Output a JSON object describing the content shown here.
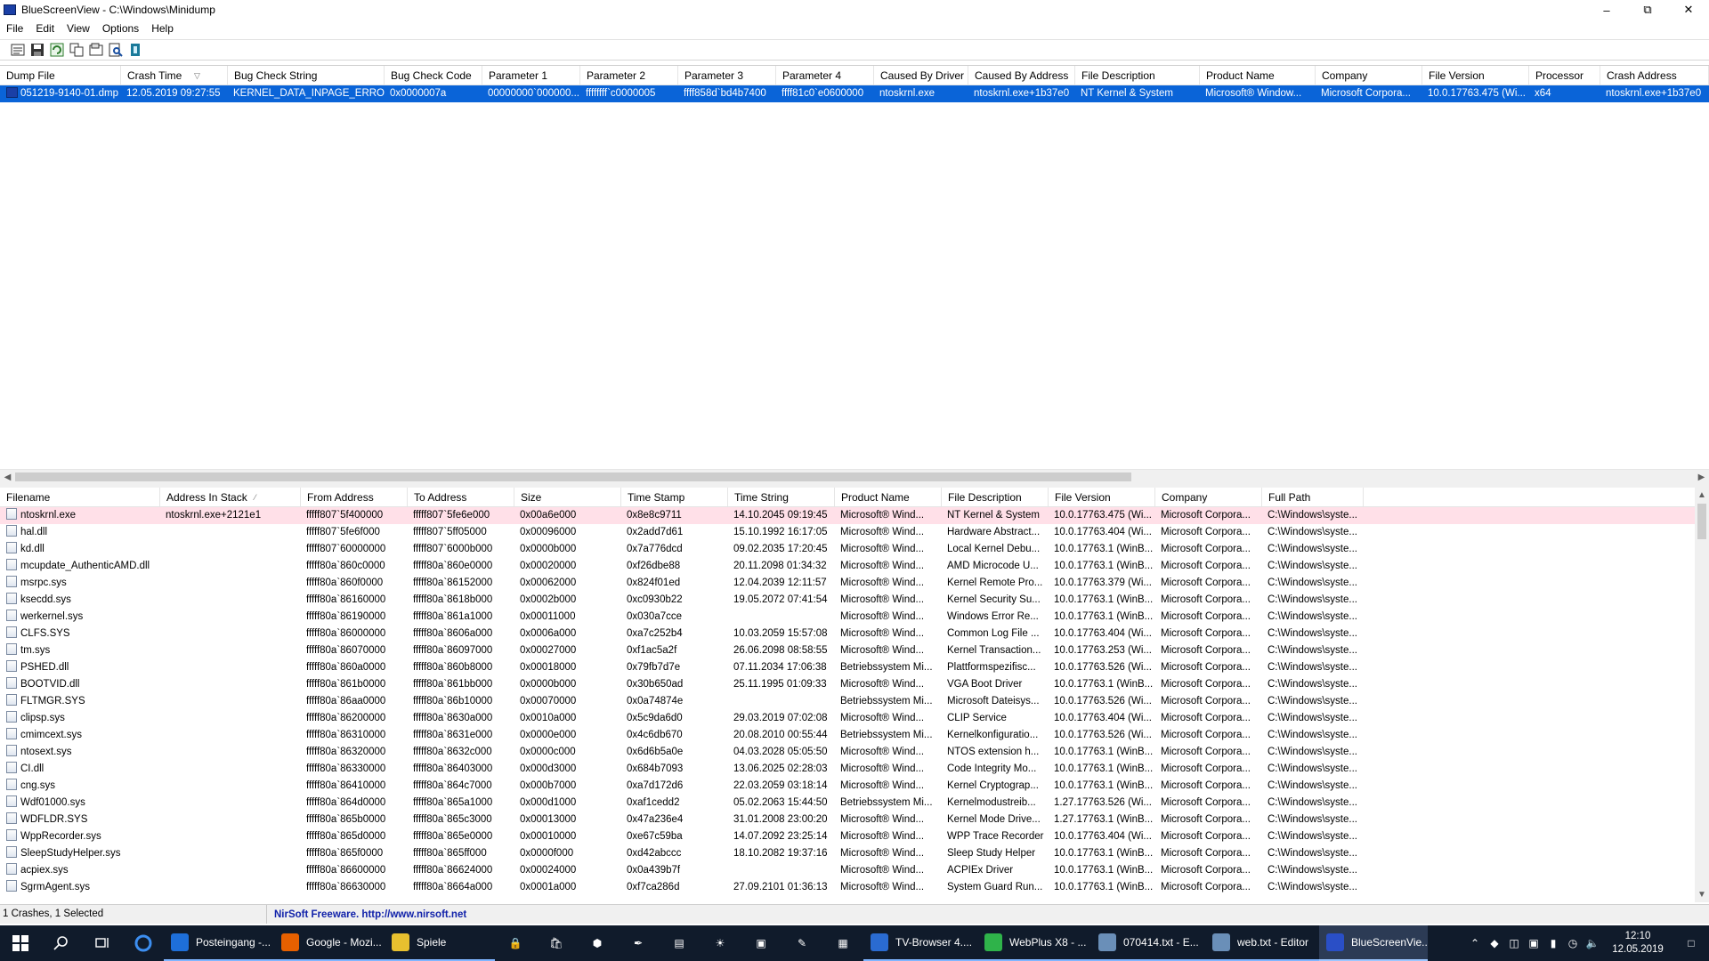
{
  "window": {
    "title": "BlueScreenView  -  C:\\Windows\\Minidump"
  },
  "menu": [
    "File",
    "Edit",
    "View",
    "Options",
    "Help"
  ],
  "toolbar": [
    "properties-icon",
    "save-icon",
    "refresh-icon",
    "copy-icon",
    "html-report-icon",
    "find-icon",
    "exit-icon"
  ],
  "top_table": {
    "columns": [
      "Dump File",
      "Crash Time",
      "Bug Check String",
      "Bug Check Code",
      "Parameter 1",
      "Parameter 2",
      "Parameter 3",
      "Parameter 4",
      "Caused By Driver",
      "Caused By Address",
      "File Description",
      "Product Name",
      "Company",
      "File Version",
      "Processor",
      "Crash Address"
    ],
    "sorted_column": "Crash Time",
    "rows": [
      [
        "051219-9140-01.dmp",
        "12.05.2019 09:27:55",
        "KERNEL_DATA_INPAGE_ERROR",
        "0x0000007a",
        "00000000`000000...",
        "ffffffff`c0000005",
        "ffff858d`bd4b7400",
        "ffff81c0`e0600000",
        "ntoskrnl.exe",
        "ntoskrnl.exe+1b37e0",
        "NT Kernel & System",
        "Microsoft® Window...",
        "Microsoft Corpora...",
        "10.0.17763.475 (Wi...",
        "x64",
        "ntoskrnl.exe+1b37e0"
      ]
    ]
  },
  "bottom_table": {
    "columns": [
      "Filename",
      "Address In Stack",
      "From Address",
      "To Address",
      "Size",
      "Time Stamp",
      "Time String",
      "Product Name",
      "File Description",
      "File Version",
      "Company",
      "Full Path"
    ],
    "sorted_column": "Address In Stack",
    "rows": [
      [
        "ntoskrnl.exe",
        "ntoskrnl.exe+2121e1",
        "fffff807`5f400000",
        "fffff807`5fe6e000",
        "0x00a6e000",
        "0x8e8c9711",
        "14.10.2045 09:19:45",
        "Microsoft® Wind...",
        "NT Kernel & System",
        "10.0.17763.475 (Wi...",
        "Microsoft Corpora...",
        "C:\\Windows\\syste..."
      ],
      [
        "hal.dll",
        "",
        "fffff807`5fe6f000",
        "fffff807`5ff05000",
        "0x00096000",
        "0x2add7d61",
        "15.10.1992 16:17:05",
        "Microsoft® Wind...",
        "Hardware Abstract...",
        "10.0.17763.404 (Wi...",
        "Microsoft Corpora...",
        "C:\\Windows\\syste..."
      ],
      [
        "kd.dll",
        "",
        "fffff807`60000000",
        "fffff807`6000b000",
        "0x0000b000",
        "0x7a776dcd",
        "09.02.2035 17:20:45",
        "Microsoft® Wind...",
        "Local Kernel Debu...",
        "10.0.17763.1 (WinB...",
        "Microsoft Corpora...",
        "C:\\Windows\\syste..."
      ],
      [
        "mcupdate_AuthenticAMD.dll",
        "",
        "fffff80a`860c0000",
        "fffff80a`860e0000",
        "0x00020000",
        "0xf26dbe88",
        "20.11.2098 01:34:32",
        "Microsoft® Wind...",
        "AMD Microcode U...",
        "10.0.17763.1 (WinB...",
        "Microsoft Corpora...",
        "C:\\Windows\\syste..."
      ],
      [
        "msrpc.sys",
        "",
        "fffff80a`860f0000",
        "fffff80a`86152000",
        "0x00062000",
        "0x824f01ed",
        "12.04.2039 12:11:57",
        "Microsoft® Wind...",
        "Kernel Remote Pro...",
        "10.0.17763.379 (Wi...",
        "Microsoft Corpora...",
        "C:\\Windows\\syste..."
      ],
      [
        "ksecdd.sys",
        "",
        "fffff80a`86160000",
        "fffff80a`8618b000",
        "0x0002b000",
        "0xc0930b22",
        "19.05.2072 07:41:54",
        "Microsoft® Wind...",
        "Kernel Security Su...",
        "10.0.17763.1 (WinB...",
        "Microsoft Corpora...",
        "C:\\Windows\\syste..."
      ],
      [
        "werkernel.sys",
        "",
        "fffff80a`86190000",
        "fffff80a`861a1000",
        "0x00011000",
        "0x030a7cce",
        "",
        "Microsoft® Wind...",
        "Windows Error Re...",
        "10.0.17763.1 (WinB...",
        "Microsoft Corpora...",
        "C:\\Windows\\syste..."
      ],
      [
        "CLFS.SYS",
        "",
        "fffff80a`86000000",
        "fffff80a`8606a000",
        "0x0006a000",
        "0xa7c252b4",
        "10.03.2059 15:57:08",
        "Microsoft® Wind...",
        "Common Log File ...",
        "10.0.17763.404 (Wi...",
        "Microsoft Corpora...",
        "C:\\Windows\\syste..."
      ],
      [
        "tm.sys",
        "",
        "fffff80a`86070000",
        "fffff80a`86097000",
        "0x00027000",
        "0xf1ac5a2f",
        "26.06.2098 08:58:55",
        "Microsoft® Wind...",
        "Kernel Transaction...",
        "10.0.17763.253 (Wi...",
        "Microsoft Corpora...",
        "C:\\Windows\\syste..."
      ],
      [
        "PSHED.dll",
        "",
        "fffff80a`860a0000",
        "fffff80a`860b8000",
        "0x00018000",
        "0x79fb7d7e",
        "07.11.2034 17:06:38",
        "Betriebssystem Mi...",
        "Plattformspezifisc...",
        "10.0.17763.526 (Wi...",
        "Microsoft Corpora...",
        "C:\\Windows\\syste..."
      ],
      [
        "BOOTVID.dll",
        "",
        "fffff80a`861b0000",
        "fffff80a`861bb000",
        "0x0000b000",
        "0x30b650ad",
        "25.11.1995 01:09:33",
        "Microsoft® Wind...",
        "VGA Boot Driver",
        "10.0.17763.1 (WinB...",
        "Microsoft Corpora...",
        "C:\\Windows\\syste..."
      ],
      [
        "FLTMGR.SYS",
        "",
        "fffff80a`86aa0000",
        "fffff80a`86b10000",
        "0x00070000",
        "0x0a74874e",
        "",
        "Betriebssystem Mi...",
        "Microsoft Dateisys...",
        "10.0.17763.526 (Wi...",
        "Microsoft Corpora...",
        "C:\\Windows\\syste..."
      ],
      [
        "clipsp.sys",
        "",
        "fffff80a`86200000",
        "fffff80a`8630a000",
        "0x0010a000",
        "0x5c9da6d0",
        "29.03.2019 07:02:08",
        "Microsoft® Wind...",
        "CLIP Service",
        "10.0.17763.404 (Wi...",
        "Microsoft Corpora...",
        "C:\\Windows\\syste..."
      ],
      [
        "cmimcext.sys",
        "",
        "fffff80a`86310000",
        "fffff80a`8631e000",
        "0x0000e000",
        "0x4c6db670",
        "20.08.2010 00:55:44",
        "Betriebssystem Mi...",
        "Kernelkonfiguratio...",
        "10.0.17763.526 (Wi...",
        "Microsoft Corpora...",
        "C:\\Windows\\syste..."
      ],
      [
        "ntosext.sys",
        "",
        "fffff80a`86320000",
        "fffff80a`8632c000",
        "0x0000c000",
        "0x6d6b5a0e",
        "04.03.2028 05:05:50",
        "Microsoft® Wind...",
        "NTOS extension h...",
        "10.0.17763.1 (WinB...",
        "Microsoft Corpora...",
        "C:\\Windows\\syste..."
      ],
      [
        "CI.dll",
        "",
        "fffff80a`86330000",
        "fffff80a`86403000",
        "0x000d3000",
        "0x684b7093",
        "13.06.2025 02:28:03",
        "Microsoft® Wind...",
        "Code Integrity Mo...",
        "10.0.17763.1 (WinB...",
        "Microsoft Corpora...",
        "C:\\Windows\\syste..."
      ],
      [
        "cng.sys",
        "",
        "fffff80a`86410000",
        "fffff80a`864c7000",
        "0x000b7000",
        "0xa7d172d6",
        "22.03.2059 03:18:14",
        "Microsoft® Wind...",
        "Kernel Cryptograp...",
        "10.0.17763.1 (WinB...",
        "Microsoft Corpora...",
        "C:\\Windows\\syste..."
      ],
      [
        "Wdf01000.sys",
        "",
        "fffff80a`864d0000",
        "fffff80a`865a1000",
        "0x000d1000",
        "0xaf1cedd2",
        "05.02.2063 15:44:50",
        "Betriebssystem Mi...",
        "Kernelmodustreib...",
        "1.27.17763.526 (Wi...",
        "Microsoft Corpora...",
        "C:\\Windows\\syste..."
      ],
      [
        "WDFLDR.SYS",
        "",
        "fffff80a`865b0000",
        "fffff80a`865c3000",
        "0x00013000",
        "0x47a236e4",
        "31.01.2008 23:00:20",
        "Microsoft® Wind...",
        "Kernel Mode Drive...",
        "1.27.17763.1 (WinB...",
        "Microsoft Corpora...",
        "C:\\Windows\\syste..."
      ],
      [
        "WppRecorder.sys",
        "",
        "fffff80a`865d0000",
        "fffff80a`865e0000",
        "0x00010000",
        "0xe67c59ba",
        "14.07.2092 23:25:14",
        "Microsoft® Wind...",
        "WPP Trace Recorder",
        "10.0.17763.404 (Wi...",
        "Microsoft Corpora...",
        "C:\\Windows\\syste..."
      ],
      [
        "SleepStudyHelper.sys",
        "",
        "fffff80a`865f0000",
        "fffff80a`865ff000",
        "0x0000f000",
        "0xd42abccc",
        "18.10.2082 19:37:16",
        "Microsoft® Wind...",
        "Sleep Study Helper",
        "10.0.17763.1 (WinB...",
        "Microsoft Corpora...",
        "C:\\Windows\\syste..."
      ],
      [
        "acpiex.sys",
        "",
        "fffff80a`86600000",
        "fffff80a`86624000",
        "0x00024000",
        "0x0a439b7f",
        "",
        "Microsoft® Wind...",
        "ACPIEx Driver",
        "10.0.17763.1 (WinB...",
        "Microsoft Corpora...",
        "C:\\Windows\\syste..."
      ],
      [
        "SgrmAgent.sys",
        "",
        "fffff80a`86630000",
        "fffff80a`8664a000",
        "0x0001a000",
        "0xf7ca286d",
        "27.09.2101 01:36:13",
        "Microsoft® Wind...",
        "System Guard Run...",
        "10.0.17763.1 (WinB...",
        "Microsoft Corpora...",
        "C:\\Windows\\syste..."
      ]
    ]
  },
  "status": {
    "left": "1 Crashes, 1 Selected",
    "right": "NirSoft Freeware.  http://www.nirsoft.net"
  },
  "taskbar": {
    "apps": [
      {
        "label": "Posteingang -...",
        "color": "#1e6fd9",
        "state": "open"
      },
      {
        "label": "Google - Mozi...",
        "color": "#e66000",
        "state": "open"
      },
      {
        "label": "Spiele",
        "color": "#e7c02f",
        "state": "open"
      },
      {
        "label": "TV-Browser 4....",
        "color": "#2a6bd1",
        "state": "open"
      },
      {
        "label": "WebPlus X8 - ...",
        "color": "#2fb34a",
        "state": "open"
      },
      {
        "label": "070414.txt - E...",
        "color": "#6a8fb8",
        "state": "open"
      },
      {
        "label": "web.txt - Editor",
        "color": "#6a8fb8",
        "state": "open"
      },
      {
        "label": "BlueScreenVie...",
        "color": "#2a4fc6",
        "state": "active"
      }
    ],
    "clock_time": "12:10",
    "clock_date": "12.05.2019"
  }
}
